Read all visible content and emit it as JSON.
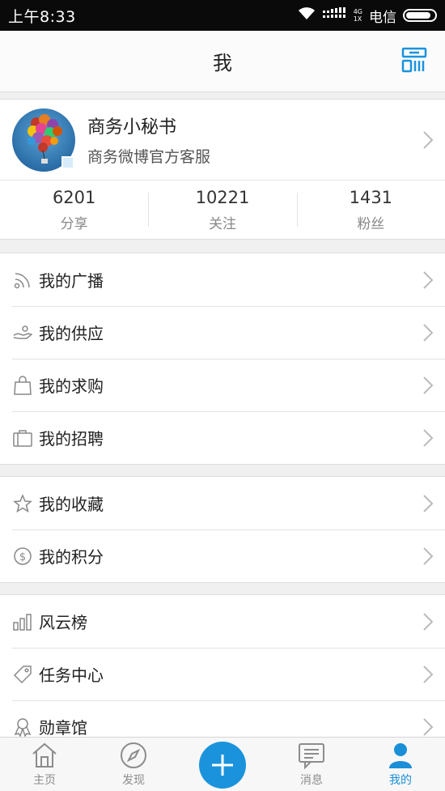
{
  "status_bar": {
    "time": "上午8:33",
    "network_top": "4G",
    "network_bottom": "1X",
    "carrier": "电信"
  },
  "header": {
    "title": "我",
    "qr_icon": "qr-code-icon"
  },
  "profile": {
    "name": "商务小秘书",
    "description": "商务微博官方客服",
    "stats": [
      {
        "value": "6201",
        "label": "分享"
      },
      {
        "value": "10221",
        "label": "关注"
      },
      {
        "value": "1431",
        "label": "粉丝"
      }
    ]
  },
  "menu_groups": [
    {
      "items": [
        {
          "label": "我的广播",
          "icon": "broadcast-icon"
        },
        {
          "label": "我的供应",
          "icon": "supply-hand-icon"
        },
        {
          "label": "我的求购",
          "icon": "shopping-bag-icon"
        },
        {
          "label": "我的招聘",
          "icon": "briefcase-icon"
        }
      ]
    },
    {
      "items": [
        {
          "label": "我的收藏",
          "icon": "star-icon"
        },
        {
          "label": "我的积分",
          "icon": "dollar-coin-icon"
        }
      ]
    },
    {
      "items": [
        {
          "label": "风云榜",
          "icon": "ranking-bars-icon"
        },
        {
          "label": "任务中心",
          "icon": "tag-icon"
        },
        {
          "label": "勋章馆",
          "icon": "medal-icon"
        }
      ]
    }
  ],
  "tabs": [
    {
      "label": "主页",
      "icon": "home-icon"
    },
    {
      "label": "发现",
      "icon": "compass-icon"
    },
    {
      "label": "",
      "icon": "plus-icon"
    },
    {
      "label": "消息",
      "icon": "message-icon"
    },
    {
      "label": "我的",
      "icon": "user-icon"
    }
  ],
  "colors": {
    "accent": "#1b93dc",
    "active_tab": "#1a8fd8"
  }
}
